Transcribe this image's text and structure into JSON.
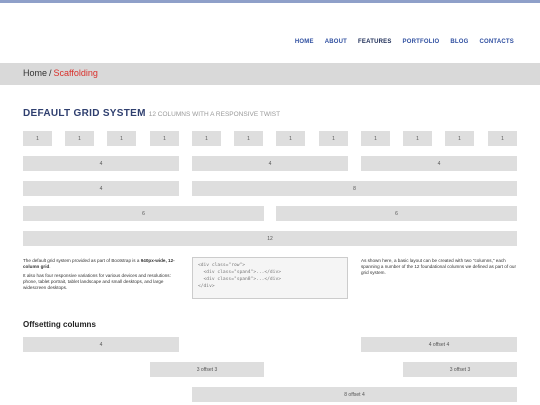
{
  "nav": {
    "items": [
      {
        "label": "HOME"
      },
      {
        "label": "ABOUT"
      },
      {
        "label": "FEATURES"
      },
      {
        "label": "PORTFOLIO"
      },
      {
        "label": "BLOG"
      },
      {
        "label": "CONTACTS"
      }
    ],
    "active": "FEATURES"
  },
  "breadcrumb": {
    "home": "Home",
    "separator": "/",
    "current": "Scaffolding"
  },
  "grid_section": {
    "title": "DEFAULT GRID SYSTEM",
    "subtitle": "12 COLUMNS WITH A RESPONSIVE TWIST",
    "row1": [
      "1",
      "1",
      "1",
      "1",
      "1",
      "1",
      "1",
      "1",
      "1",
      "1",
      "1",
      "1"
    ],
    "row2": [
      "4",
      "4",
      "4"
    ],
    "row3": [
      "4",
      "8"
    ],
    "row4": [
      "6",
      "6"
    ],
    "row5": [
      "12"
    ]
  },
  "description": {
    "p1_pre": "The default grid system provided as part of Bootstrap is a ",
    "p1_bold": "940px-wide, 12-column grid",
    "p1_post": ".",
    "p2": "It also has four responsive variations for various devices and resolutions: phone, tablet portrait, tablet landscape and small desktops, and large widescreen desktops.",
    "right": "As shown here, a basic layout can be created with two \"columns,\" each spanning a number of the 12 foundational columns we defined as part of our grid system."
  },
  "code_sample": {
    "lines": [
      "<div class=\"row\">",
      "  <div class=\"span4\">...</div>",
      "  <div class=\"span8\">...</div>",
      "</div>"
    ]
  },
  "offset_section": {
    "title": "Offsetting columns",
    "row1": [
      "4",
      "4 offset 4"
    ],
    "row2": [
      "3 offset 3",
      "3 offset 3"
    ],
    "row3": [
      "8 offset 4"
    ]
  }
}
